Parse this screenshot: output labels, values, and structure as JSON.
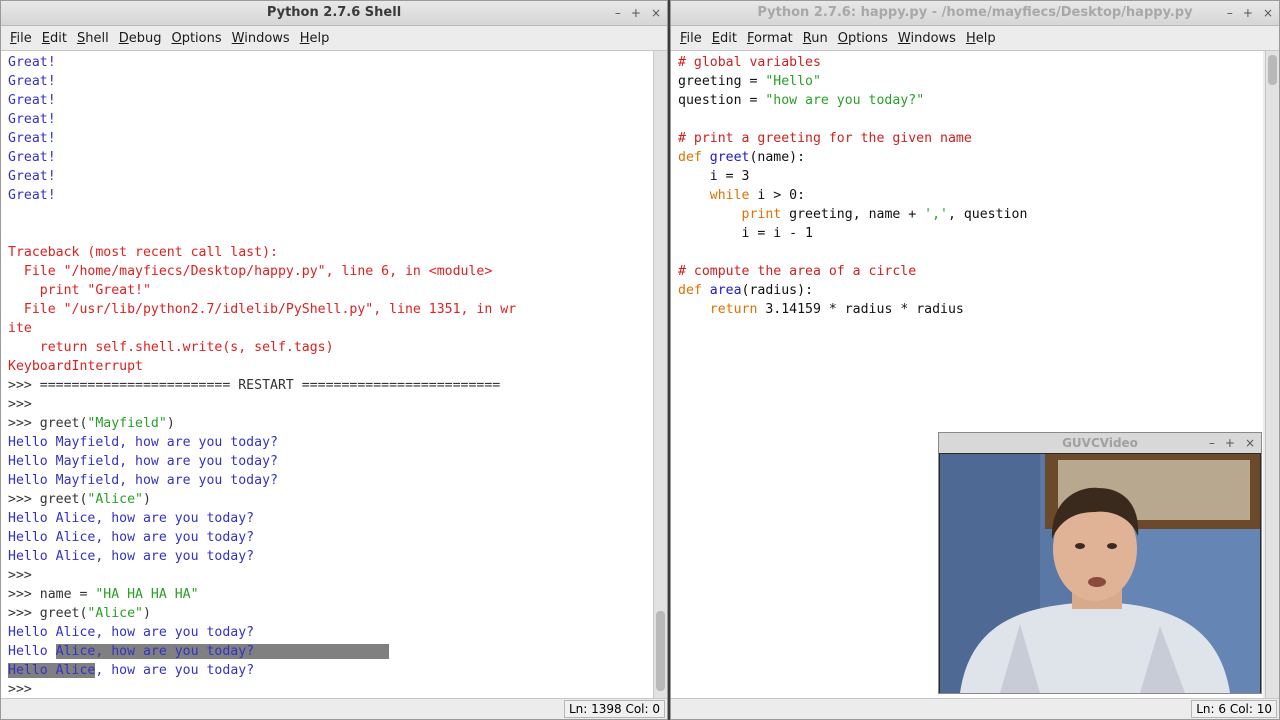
{
  "shell": {
    "title": "Python 2.7.6 Shell",
    "menu": [
      "File",
      "Edit",
      "Shell",
      "Debug",
      "Options",
      "Windows",
      "Help"
    ],
    "status": "Ln: 1398 Col: 0",
    "lines": [
      [
        {
          "t": "Great!",
          "c": "c-out"
        }
      ],
      [
        {
          "t": "Great!",
          "c": "c-out"
        }
      ],
      [
        {
          "t": "Great!",
          "c": "c-out"
        }
      ],
      [
        {
          "t": "Great!",
          "c": "c-out"
        }
      ],
      [
        {
          "t": "Great!",
          "c": "c-out"
        }
      ],
      [
        {
          "t": "Great!",
          "c": "c-out"
        }
      ],
      [
        {
          "t": "Great!",
          "c": "c-out"
        }
      ],
      [
        {
          "t": "Great!",
          "c": "c-out"
        }
      ],
      [],
      [],
      [
        {
          "t": "Traceback (most recent call last):",
          "c": "c-err"
        }
      ],
      [
        {
          "t": "  File \"/home/mayfiecs/Desktop/happy.py\", line 6, in <module>",
          "c": "c-err"
        }
      ],
      [
        {
          "t": "    print \"Great!\"",
          "c": "c-err"
        }
      ],
      [
        {
          "t": "  File \"/usr/lib/python2.7/idlelib/PyShell.py\", line 1351, in wr",
          "c": "c-err"
        }
      ],
      [
        {
          "t": "ite",
          "c": "c-err"
        }
      ],
      [
        {
          "t": "    return self.shell.write(s, self.tags)",
          "c": "c-err"
        }
      ],
      [
        {
          "t": "KeyboardInterrupt",
          "c": "c-err"
        }
      ],
      [
        {
          "t": ">>> ======================== RESTART =========================",
          "c": "c-prompt"
        }
      ],
      [
        {
          "t": ">>>",
          "c": "c-prompt"
        }
      ],
      [
        {
          "t": ">>> greet(",
          "c": "c-prompt"
        },
        {
          "t": "\"Mayfield\"",
          "c": "c-str"
        },
        {
          "t": ")",
          "c": "c-prompt"
        }
      ],
      [
        {
          "t": "Hello Mayfield, how are you today?",
          "c": "c-out"
        }
      ],
      [
        {
          "t": "Hello Mayfield, how are you today?",
          "c": "c-out"
        }
      ],
      [
        {
          "t": "Hello Mayfield, how are you today?",
          "c": "c-out"
        }
      ],
      [
        {
          "t": ">>> greet(",
          "c": "c-prompt"
        },
        {
          "t": "\"Alice\"",
          "c": "c-str"
        },
        {
          "t": ")",
          "c": "c-prompt"
        }
      ],
      [
        {
          "t": "Hello Alice, how are you today?",
          "c": "c-out"
        }
      ],
      [
        {
          "t": "Hello Alice, how are you today?",
          "c": "c-out"
        }
      ],
      [
        {
          "t": "Hello Alice, how are you today?",
          "c": "c-out"
        }
      ],
      [
        {
          "t": ">>>",
          "c": "c-prompt"
        }
      ],
      [
        {
          "t": ">>> name = ",
          "c": "c-prompt"
        },
        {
          "t": "\"HA HA HA HA\"",
          "c": "c-str"
        }
      ],
      [
        {
          "t": ">>> greet(",
          "c": "c-prompt"
        },
        {
          "t": "\"Alice\"",
          "c": "c-str"
        },
        {
          "t": ")",
          "c": "c-prompt"
        }
      ],
      [
        {
          "t": "Hello Alice, how are you today?",
          "c": "c-out"
        }
      ],
      [
        {
          "t": "Hello ",
          "c": "c-out"
        },
        {
          "t": "Alice, how are you today?                 ",
          "c": "c-out sel"
        }
      ],
      [
        {
          "t": "Hello Alice",
          "c": "c-out sel"
        },
        {
          "t": ", how are you today?",
          "c": "c-out"
        }
      ],
      [
        {
          "t": ">>> ",
          "c": "c-prompt"
        }
      ]
    ]
  },
  "editor": {
    "title": "Python 2.7.6: happy.py - /home/mayfiecs/Desktop/happy.py",
    "menu": [
      "File",
      "Edit",
      "Format",
      "Run",
      "Options",
      "Windows",
      "Help"
    ],
    "status": "Ln: 6 Col: 10",
    "lines": [
      [
        {
          "t": "# global variables",
          "c": "c-com"
        }
      ],
      [
        {
          "t": "greeting = ",
          "c": "c-plain"
        },
        {
          "t": "\"Hello\"",
          "c": "c-str"
        }
      ],
      [
        {
          "t": "question = ",
          "c": "c-plain"
        },
        {
          "t": "\"how are you today?\"",
          "c": "c-str"
        }
      ],
      [],
      [
        {
          "t": "# print a greeting for the given name",
          "c": "c-com"
        }
      ],
      [
        {
          "t": "def",
          "c": "c-kw"
        },
        {
          "t": " ",
          "c": "c-plain"
        },
        {
          "t": "greet",
          "c": "c-def"
        },
        {
          "t": "(name):",
          "c": "c-plain"
        }
      ],
      [
        {
          "t": "    i = 3",
          "c": "c-plain"
        }
      ],
      [
        {
          "t": "    ",
          "c": "c-plain"
        },
        {
          "t": "while",
          "c": "c-kw"
        },
        {
          "t": " i > 0:",
          "c": "c-plain"
        }
      ],
      [
        {
          "t": "        ",
          "c": "c-plain"
        },
        {
          "t": "print",
          "c": "c-kw"
        },
        {
          "t": " greeting, name + ",
          "c": "c-plain"
        },
        {
          "t": "','",
          "c": "c-str"
        },
        {
          "t": ", question",
          "c": "c-plain"
        }
      ],
      [
        {
          "t": "        i = i - 1",
          "c": "c-plain"
        }
      ],
      [],
      [
        {
          "t": "# compute the area of a circle",
          "c": "c-com"
        }
      ],
      [
        {
          "t": "def",
          "c": "c-kw"
        },
        {
          "t": " ",
          "c": "c-plain"
        },
        {
          "t": "area",
          "c": "c-def"
        },
        {
          "t": "(radius):",
          "c": "c-plain"
        }
      ],
      [
        {
          "t": "    ",
          "c": "c-plain"
        },
        {
          "t": "return",
          "c": "c-kw"
        },
        {
          "t": " 3.14159 * radius * radius",
          "c": "c-plain"
        }
      ]
    ]
  },
  "video": {
    "title": "GUVCVideo"
  },
  "window_controls": [
    "–",
    "+",
    "×"
  ]
}
